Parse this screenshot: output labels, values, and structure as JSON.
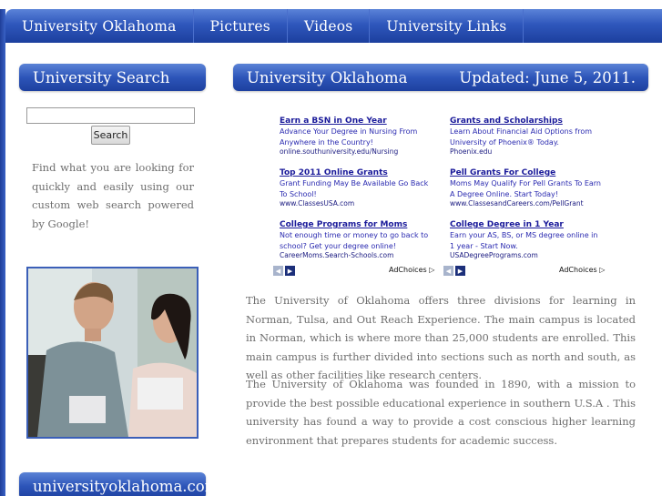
{
  "nav": {
    "items": [
      "University Oklahoma",
      "Pictures",
      "Videos",
      "University Links"
    ]
  },
  "sidebar": {
    "search_title": "University Search",
    "search_placeholder": "",
    "search_button": "Search",
    "search_desc": "Find what you are looking for quickly and easily using our custom web search powered by Google!",
    "footer_title": "universityoklahoma.com"
  },
  "main": {
    "title": "University Oklahoma",
    "updated": "Updated: June 5, 2011."
  },
  "ads": [
    {
      "headline": "Earn a BSN in One Year",
      "desc": "Advance Your Degree in Nursing From Anywhere in the Country!",
      "url": "online.southuniversity.edu/Nursing"
    },
    {
      "headline": "Grants and Scholarships",
      "desc": "Learn About Financial Aid Options from University of Phoenix® Today.",
      "url": "Phoenix.edu"
    },
    {
      "headline": "Top 2011 Online Grants",
      "desc": "Grant Funding May Be Available Go Back To School!",
      "url": "www.ClassesUSA.com"
    },
    {
      "headline": "Pell Grants For College",
      "desc": "Moms May Qualify For Pell Grants To Earn A Degree Online. Start Today!",
      "url": "www.ClassesandCareers.com/PellGrant"
    },
    {
      "headline": "College Programs for Moms",
      "desc": "Not enough time or money to go back to school? Get your degree online!",
      "url": "CareerMoms.Search-Schools.com"
    },
    {
      "headline": "College Degree in 1 Year",
      "desc": "Earn your AS, BS, or MS degree online in 1 year - Start Now.",
      "url": "USADegreePrograms.com"
    }
  ],
  "adchoices": "AdChoices",
  "paragraphs": [
    "The University of Oklahoma offers three divisions for learning in Norman, Tulsa, and Out Reach Experience. The main campus is located in Norman, which is where more than 25,000 students are enrolled. This main campus is further divided into sections such as north and south, as well as other facilities like research centers.",
    "The University of Oklahoma was founded in 1890, with a mission to provide the best possible educational experience in southern U.S.A . This university has found a way to provide a cost conscious higher learning environment that prepares students for academic success."
  ],
  "colors": {
    "brand_blue": "#2d55b9",
    "ad_link": "#1a1a9a",
    "body_text": "#6e6e6e"
  }
}
